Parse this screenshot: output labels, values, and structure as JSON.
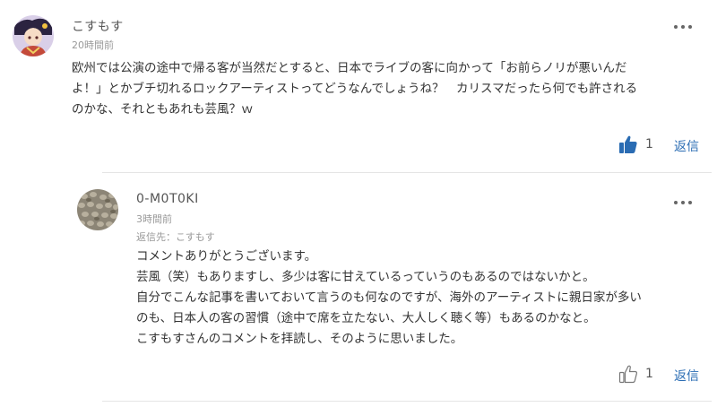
{
  "comment": {
    "username": "こすもす",
    "timestamp": "20時間前",
    "body_lines": [
      "欧州では公演の途中で帰る客が当然だとすると、日本でライブの客に向かって「お前らノリが悪いんだ",
      "よ！」とかブチ切れるロックアーティストってどうなんでしょうね？　カリスマだったら何でも許される",
      "のかな、それともあれも芸風？ｗ"
    ],
    "like_count": "1",
    "reply_label": "返信",
    "like_state": "liked",
    "like_color": "#2a6cb3"
  },
  "reply": {
    "username": "0-M0T0KI",
    "timestamp": "3時間前",
    "reply_to": "返信先：こすもす",
    "body_lines": [
      "コメントありがとうございます。",
      "芸風（笑）もありますし、多少は客に甘えているっていうのもあるのではないかと。",
      "自分でこんな記事を書いておいて言うのも何なのですが、海外のアーティストに親日家が多い",
      "のも、日本人の客の習慣（途中で席を立たない、大人しく聴く等）もあるのかなと。",
      "こすもすさんのコメントを拝読し、そのように思いました。"
    ],
    "like_count": "1",
    "reply_label": "返信",
    "like_state": "not-liked"
  }
}
